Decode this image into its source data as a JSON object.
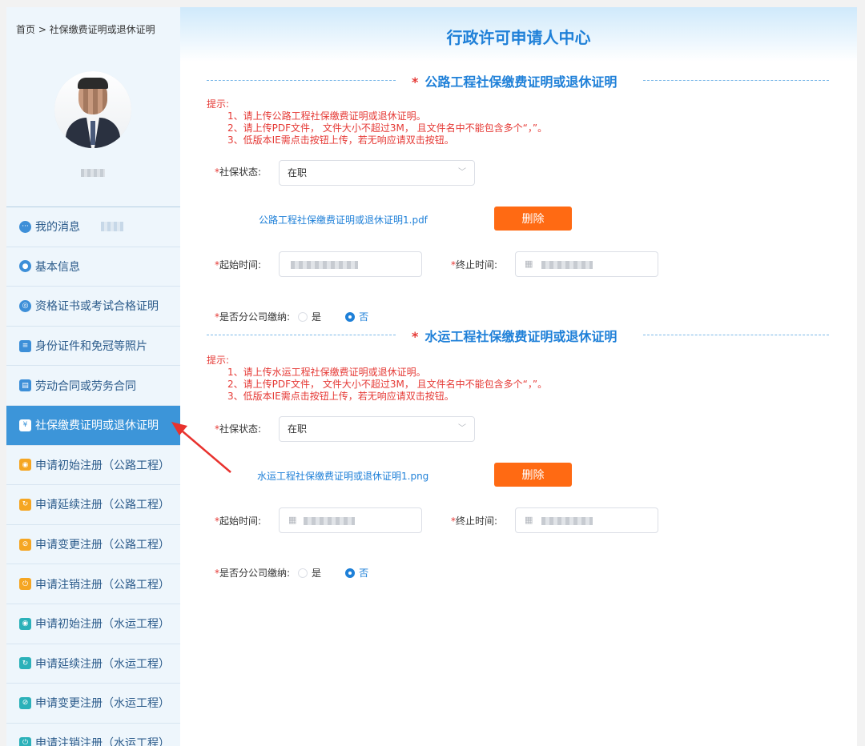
{
  "sidebar": {
    "breadcrumb": "首页 > 社保缴费证明或退休证明",
    "items": [
      {
        "label": "我的消息",
        "icon": "message-icon"
      },
      {
        "label": "基本信息",
        "icon": "user-icon"
      },
      {
        "label": "资格证书或考试合格证明",
        "icon": "certificate-icon"
      },
      {
        "label": "身份证件和免冠等照片",
        "icon": "id-card-icon"
      },
      {
        "label": "劳动合同或劳务合同",
        "icon": "contract-icon"
      },
      {
        "label": "社保缴费证明或退休证明",
        "icon": "social-security-icon"
      },
      {
        "label": "申请初始注册（公路工程）",
        "icon": "register-icon"
      },
      {
        "label": "申请延续注册（公路工程）",
        "icon": "renew-icon"
      },
      {
        "label": "申请变更注册（公路工程）",
        "icon": "change-icon"
      },
      {
        "label": "申请注销注册（公路工程）",
        "icon": "cancel-icon"
      },
      {
        "label": "申请初始注册（水运工程）",
        "icon": "register-icon"
      },
      {
        "label": "申请延续注册（水运工程）",
        "icon": "renew-icon"
      },
      {
        "label": "申请变更注册（水运工程）",
        "icon": "change-icon"
      },
      {
        "label": "申请注销注册（水运工程）",
        "icon": "cancel-icon"
      }
    ]
  },
  "header": {
    "title": "行政许可申请人中心"
  },
  "sections": [
    {
      "star": "*",
      "title": "公路工程社保缴费证明或退休证明",
      "tips_title": "提示:",
      "tips": [
        "1、请上传公路工程社保缴费证明或退休证明。",
        "2、请上传PDF文件， 文件大小不超过3M， 且文件名中不能包含多个“，”。",
        "3、低版本IE需点击按钮上传，若无响应请双击按钮。"
      ],
      "status_label": "社保状态:",
      "status_value": "在职",
      "file_name": "公路工程社保缴费证明或退休证明1.pdf",
      "delete_label": "删除",
      "start_label": "起始时间:",
      "end_label": "终止时间:",
      "branch_label": "是否分公司缴纳:",
      "yes_label": "是",
      "no_label": "否"
    },
    {
      "star": "*",
      "title": "水运工程社保缴费证明或退休证明",
      "tips_title": "提示:",
      "tips": [
        "1、请上传水运工程社保缴费证明或退休证明。",
        "2、请上传PDF文件， 文件大小不超过3M， 且文件名中不能包含多个“，”。",
        "3、低版本IE需点击按钮上传，若无响应请双击按钮。"
      ],
      "status_label": "社保状态:",
      "status_value": "在职",
      "file_name": "水运工程社保缴费证明或退休证明1.png",
      "delete_label": "删除",
      "start_label": "起始时间:",
      "end_label": "终止时间:",
      "branch_label": "是否分公司缴纳:",
      "yes_label": "是",
      "no_label": "否"
    }
  ],
  "required_mark": "*",
  "colors": {
    "accent": "#1f80d8",
    "active_menu": "#3c95d9",
    "danger": "#e53935",
    "delete_button": "#ff6a13",
    "annotation_arrow": "#e8322e"
  }
}
